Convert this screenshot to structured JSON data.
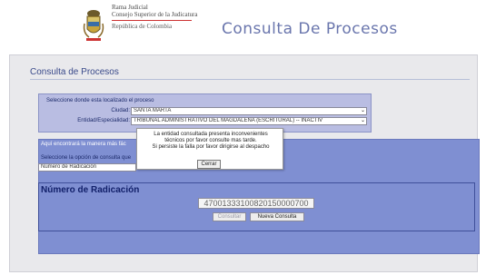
{
  "header": {
    "org_line1": "Rama Judicial",
    "org_line2": "Consejo Superior de la Judicatura",
    "org_line3": "República de Colombia",
    "title": "Consulta De Procesos"
  },
  "page": {
    "title": "Consulta de Procesos"
  },
  "location_form": {
    "section_label": "Seleccione donde esta localizado el proceso",
    "ciudad_label": "Ciudad:",
    "ciudad_value": "SANTA MARTA",
    "entidad_label": "Entidad/Especialidad:",
    "entidad_value": "TRIBUNAL ADMINISTRATIVO DEL MAGDALENA (ESCRITURAL) -- INACTIV"
  },
  "search_panel": {
    "intro_text": "Aquí encontrará la manera más fác",
    "option_label": "Seleccione la opción de consulta que",
    "option_value": "Número de Radicación"
  },
  "radicacion": {
    "title": "Número de Radicación",
    "number_value": "47001333100820150000700",
    "consultar_label": "Consultar",
    "nueva_label": "Nueva Consulta"
  },
  "modal": {
    "message_line1": "La entidad consultada presenta inconvenientes",
    "message_line2": "técnicos por favor consulte mas tarde.",
    "message_line3": "Si persiste la falla por favor dirigirse al despacho",
    "close_label": "Cerrar"
  }
}
